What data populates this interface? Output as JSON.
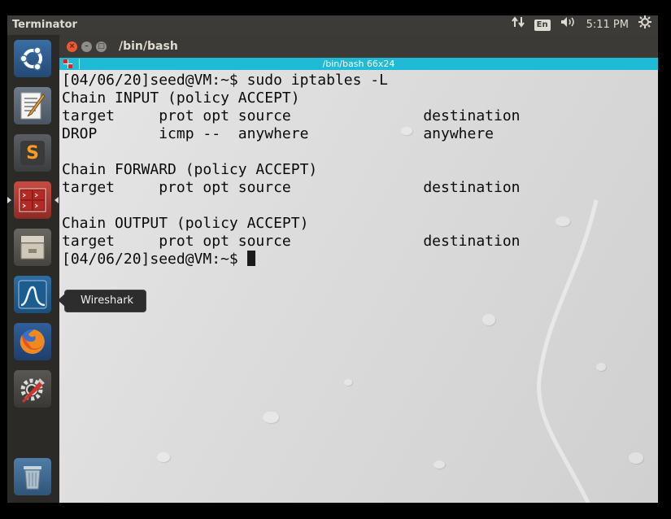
{
  "top_panel": {
    "app_title": "Terminator",
    "network_icon": "network-arrows-icon",
    "keyboard_layout": "En",
    "volume_icon": "speaker-icon",
    "clock": "5:11 PM",
    "settings_icon": "gear-icon"
  },
  "launcher": {
    "items": [
      {
        "name": "ubuntu-dash",
        "icon": "ubuntu-logo-icon"
      },
      {
        "name": "text-editor",
        "icon": "text-editor-icon"
      },
      {
        "name": "sublime-text",
        "icon": "sublime-text-icon"
      },
      {
        "name": "terminator",
        "icon": "terminator-icon",
        "active": true
      },
      {
        "name": "file-manager",
        "icon": "file-cabinet-icon"
      },
      {
        "name": "wireshark",
        "icon": "wireshark-icon"
      },
      {
        "name": "firefox",
        "icon": "firefox-icon"
      },
      {
        "name": "system-settings",
        "icon": "settings-tools-icon"
      },
      {
        "name": "trash",
        "icon": "trash-icon"
      }
    ],
    "tooltip": "Wireshark"
  },
  "window": {
    "title": "/bin/bash",
    "tab_title": "/bin/bash 66x24",
    "colors": {
      "tab_bar": "#1fbad6",
      "close_button": "#e85b32",
      "scroll_indicator": "#e06a2c"
    }
  },
  "terminal": {
    "lines": [
      "[04/06/20]seed@VM:~$ sudo iptables -L",
      "Chain INPUT (policy ACCEPT)",
      "target     prot opt source               destination",
      "DROP       icmp --  anywhere             anywhere",
      "",
      "Chain FORWARD (policy ACCEPT)",
      "target     prot opt source               destination",
      "",
      "Chain OUTPUT (policy ACCEPT)",
      "target     prot opt source               destination"
    ],
    "prompt": "[04/06/20]seed@VM:~$ "
  }
}
